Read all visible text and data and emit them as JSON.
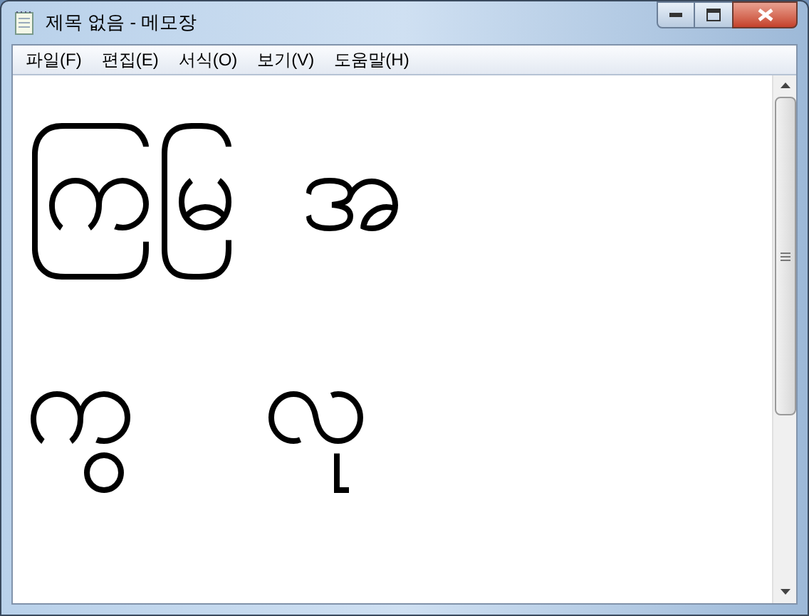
{
  "window": {
    "title": "제목 없음 - 메모장"
  },
  "menu": [
    "파일(F)",
    "편집(E)",
    "서식(O)",
    "보기(V)",
    "도움말(H)"
  ],
  "document": {
    "lines": [
      "ကြမြ  အ",
      "ကွ    လု"
    ]
  }
}
